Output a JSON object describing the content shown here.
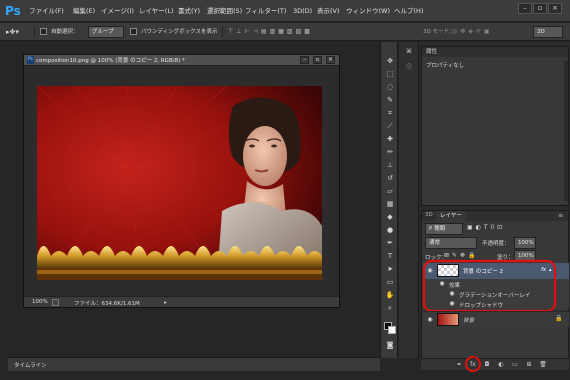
{
  "app": {
    "logo": "Ps",
    "accent": "#31a8ff"
  },
  "menu": [
    "ファイル(F)",
    "編集(E)",
    "イメージ(I)",
    "レイヤー(L)",
    "書式(Y)",
    "選択範囲(S)",
    "フィルター(T)",
    "3D(D)",
    "表示(V)",
    "ウィンドウ(W)",
    "ヘルプ(H)"
  ],
  "options_bar": {
    "auto_select": "自動選択：",
    "group_select": "グループ",
    "show_bbox": "バウンディングボックスを表示",
    "mode_3d": "3D モード：",
    "workspace": "3D"
  },
  "document": {
    "title": "composition10.png @ 100% (背景 のコピー 2, RGB/8) *",
    "zoom": "100%",
    "file_info": "ファイル：634.6K/1.61M"
  },
  "panels": {
    "properties_tab": "属性",
    "properties_text": "プロパティなし",
    "tab_3d": "3D",
    "tab_layers": "レイヤー",
    "kind_label": "P 種類",
    "blend_mode": "通常",
    "opacity_label": "不透明度：",
    "opacity_value": "100%",
    "lock_label": "ロック：",
    "fill_label": "塗り：",
    "fill_value": "100%"
  },
  "layers": [
    {
      "name": "背景 のコピー 2",
      "fx": "fx",
      "effects_label": "効果",
      "effects": [
        "グラデーションオーバーレイ",
        "ドロップシャドウ"
      ]
    },
    {
      "name": "背景"
    }
  ],
  "timeline": {
    "label": "タイムライン"
  }
}
